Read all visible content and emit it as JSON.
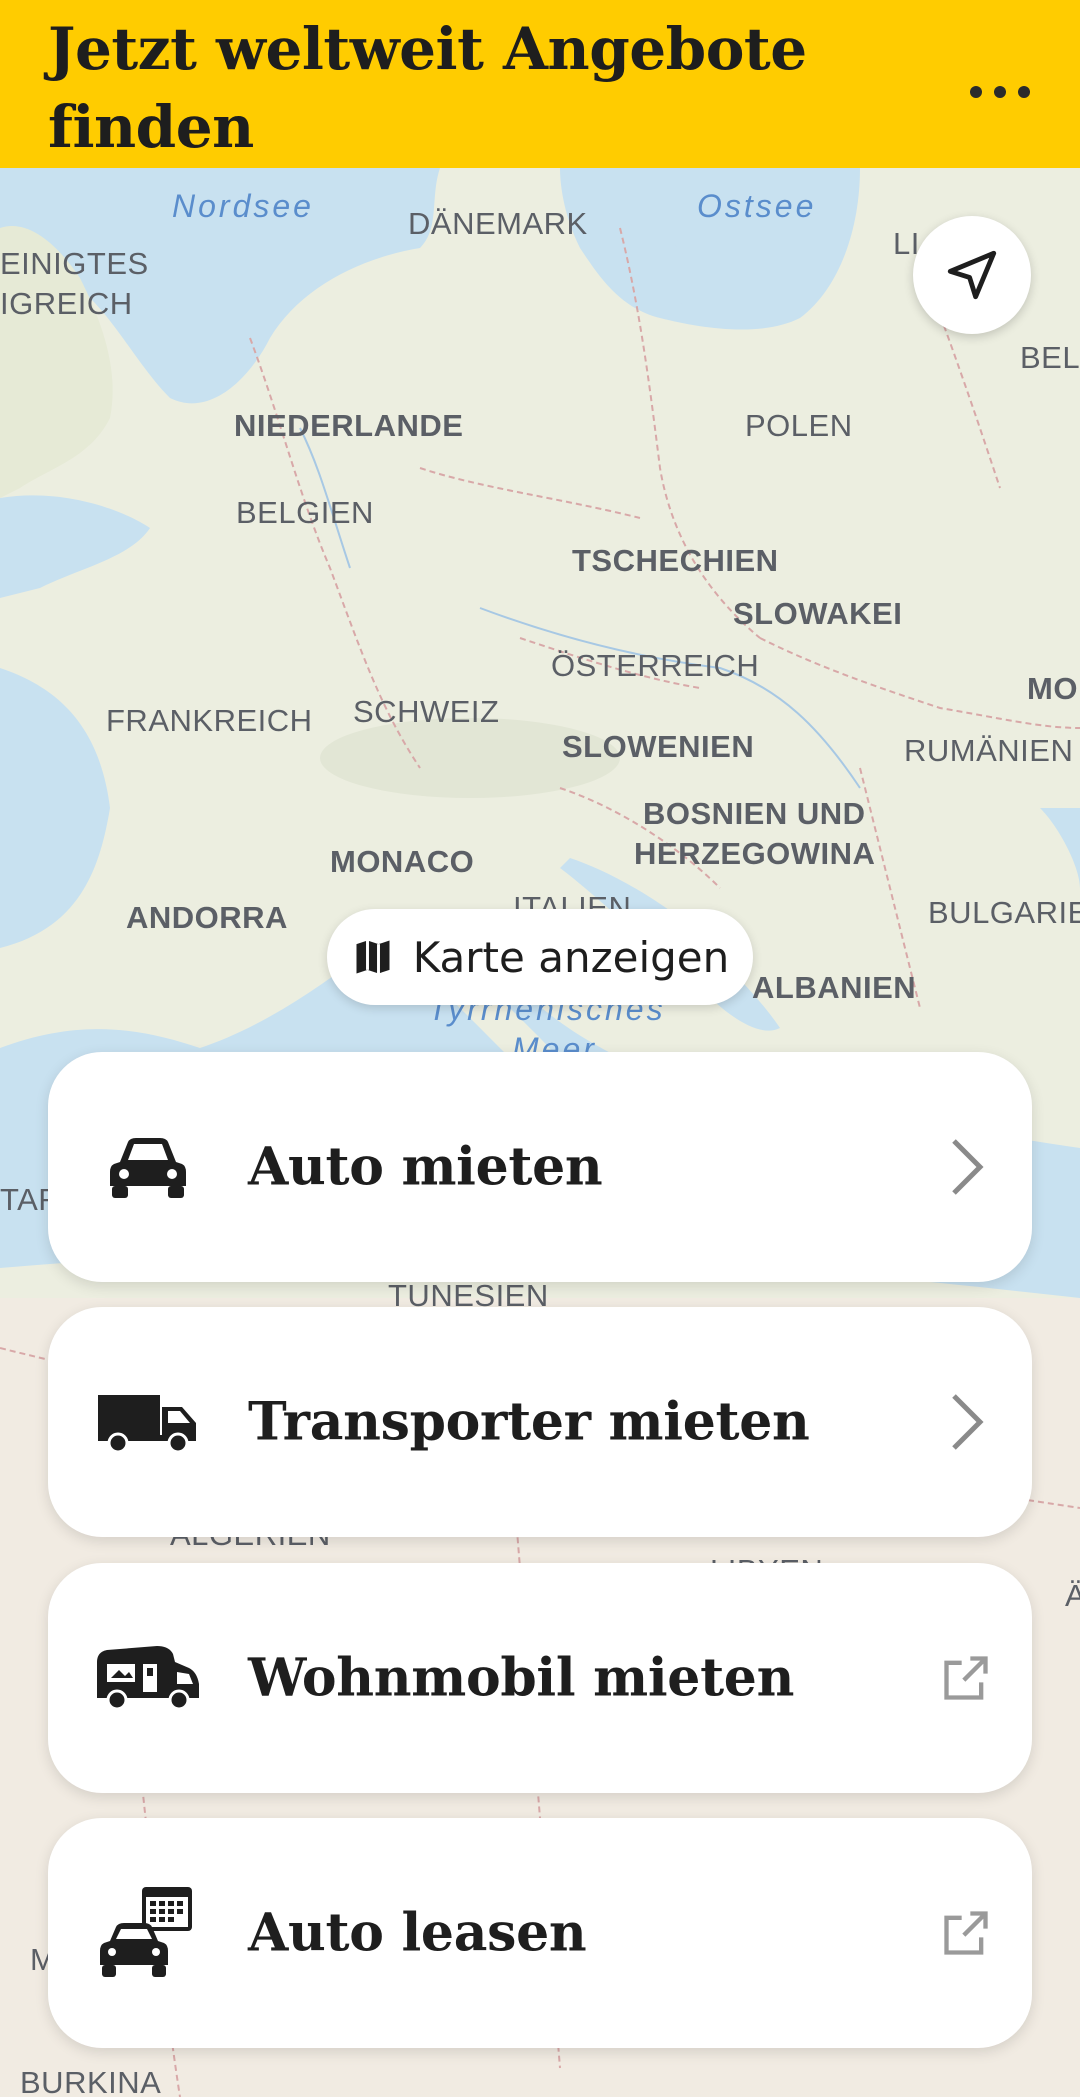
{
  "header": {
    "title": "Jetzt weltweit Angebote finden",
    "menu_icon": "more-horizontal-icon",
    "background_color": "#ffcc00"
  },
  "map": {
    "labels": [
      {
        "name": "sea-nordsee",
        "text": "Nordsee",
        "type": "sea"
      },
      {
        "name": "sea-ostsee",
        "text": "Ostsee",
        "type": "sea"
      },
      {
        "name": "country-daenemark",
        "text": "DÄNEMARK"
      },
      {
        "name": "country-uk-1",
        "text": "EINIGTES"
      },
      {
        "name": "country-uk-2",
        "text": "IGREICH"
      },
      {
        "name": "country-litauen",
        "text": "LI"
      },
      {
        "name": "country-belarus",
        "text": "BEL"
      },
      {
        "name": "country-niederlande",
        "text": "NIEDERLANDE"
      },
      {
        "name": "country-polen",
        "text": "POLEN"
      },
      {
        "name": "country-belgien",
        "text": "BELGIEN"
      },
      {
        "name": "country-tschechien",
        "text": "TSCHECHIEN"
      },
      {
        "name": "country-slowakei",
        "text": "SLOWAKEI"
      },
      {
        "name": "country-oesterreich",
        "text": "ÖSTERREICH"
      },
      {
        "name": "country-moldau",
        "text": "MO"
      },
      {
        "name": "country-frankreich",
        "text": "FRANKREICH"
      },
      {
        "name": "country-schweiz",
        "text": "SCHWEIZ"
      },
      {
        "name": "country-slowenien",
        "text": "SLOWENIEN"
      },
      {
        "name": "country-rumaenien",
        "text": "RUMÄNIEN"
      },
      {
        "name": "country-bosnien-1",
        "text": "BOSNIEN UND"
      },
      {
        "name": "country-bosnien-2",
        "text": "HERZEGOWINA"
      },
      {
        "name": "country-monaco",
        "text": "MONACO"
      },
      {
        "name": "country-andorra",
        "text": "ANDORRA"
      },
      {
        "name": "country-italien",
        "text": "ITALIEN"
      },
      {
        "name": "country-bulgarien",
        "text": "BULGARIE"
      },
      {
        "name": "country-albanien",
        "text": "ALBANIEN"
      },
      {
        "name": "sea-tyrrhenisches-1",
        "text": "Tyrrhenisches",
        "type": "sea"
      },
      {
        "name": "sea-tyrrhenisches-2",
        "text": "Meer",
        "type": "sea"
      },
      {
        "name": "country-tar",
        "text": "TAR"
      },
      {
        "name": "country-tunesien",
        "text": "TUNESIEN"
      },
      {
        "name": "country-algerien",
        "text": "ALGERIEN"
      },
      {
        "name": "country-libyen",
        "text": "LIBYEN"
      },
      {
        "name": "country-aegypten",
        "text": "Ä"
      },
      {
        "name": "country-mali",
        "text": "M"
      },
      {
        "name": "country-burkina",
        "text": "BURKINA"
      }
    ],
    "locate_button_icon": "navigation-arrow-icon",
    "show_map_button": {
      "label": "Karte anzeigen",
      "icon": "map-icon"
    }
  },
  "options": [
    {
      "label": "Auto mieten",
      "icon": "car-icon",
      "trailing_icon": "chevron-right-icon"
    },
    {
      "label": "Transporter mieten",
      "icon": "truck-icon",
      "trailing_icon": "chevron-right-icon"
    },
    {
      "label": "Wohnmobil mieten",
      "icon": "camper-icon",
      "trailing_icon": "external-link-icon"
    },
    {
      "label": "Auto leasen",
      "icon": "car-lease-icon",
      "trailing_icon": "external-link-icon"
    }
  ]
}
